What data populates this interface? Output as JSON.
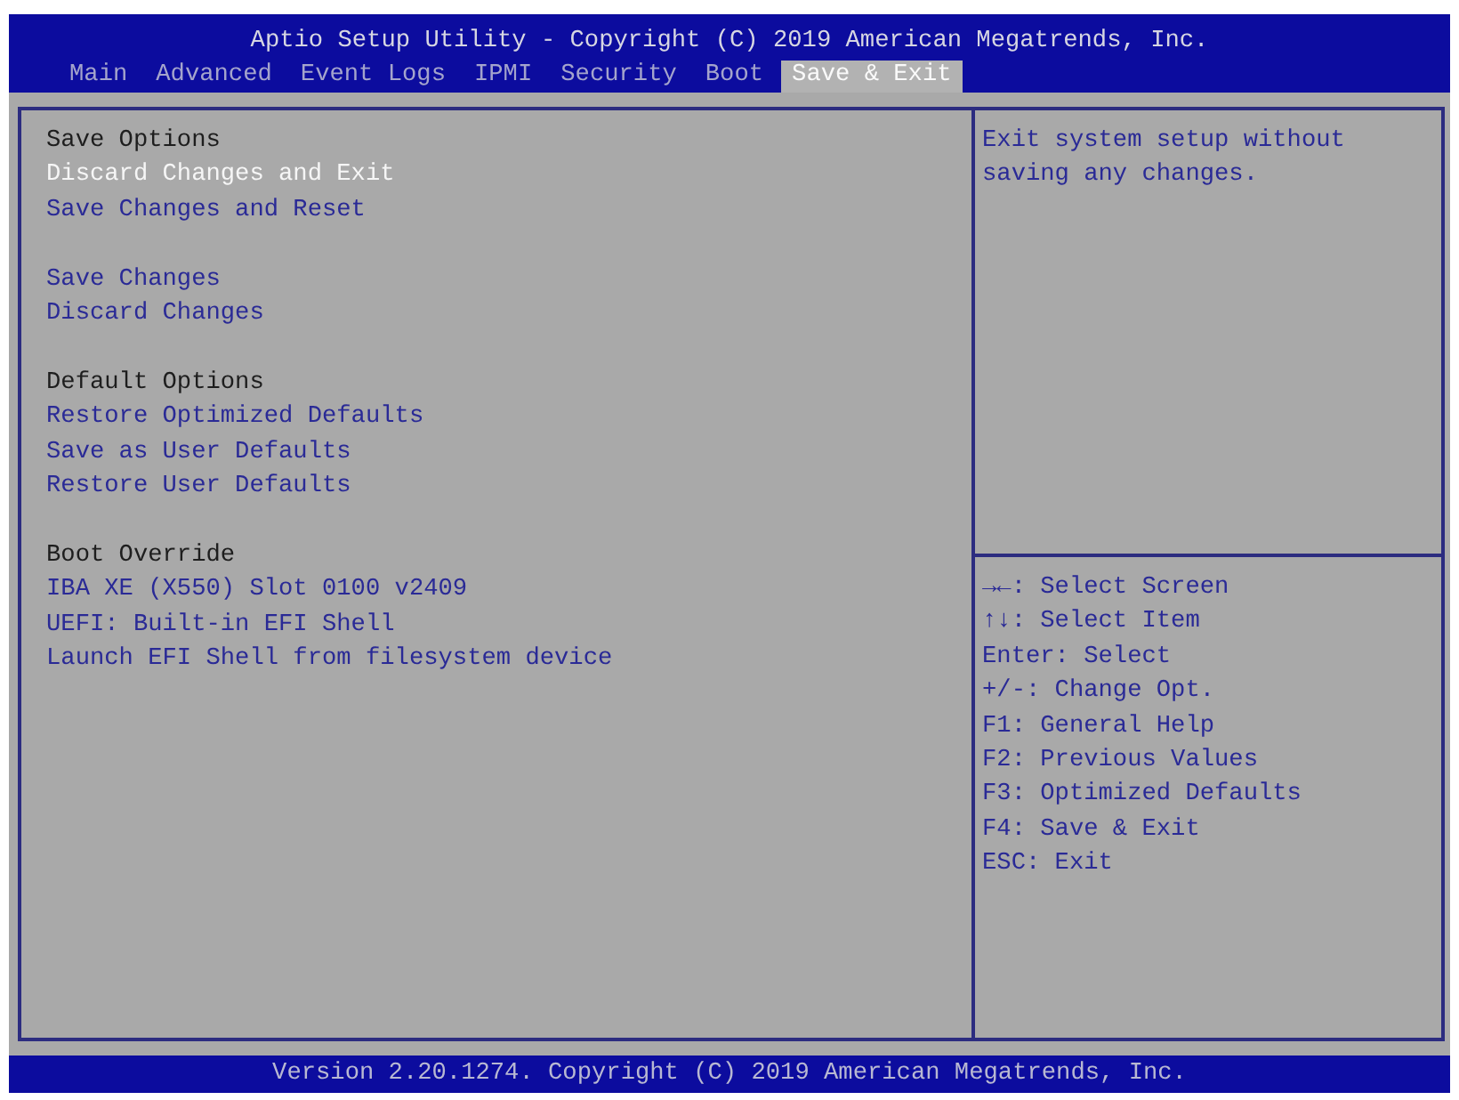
{
  "window": {
    "title": "Aptio Setup Utility - Copyright (C) 2019 American Megatrends, Inc."
  },
  "tabs": [
    {
      "label": "Main",
      "selected": false
    },
    {
      "label": "Advanced",
      "selected": false
    },
    {
      "label": "Event Logs",
      "selected": false
    },
    {
      "label": "IPMI",
      "selected": false
    },
    {
      "label": "Security",
      "selected": false
    },
    {
      "label": "Boot",
      "selected": false
    },
    {
      "label": "Save & Exit",
      "selected": true
    }
  ],
  "sections": [
    {
      "heading": "Save Options",
      "items": [
        {
          "text": "Discard Changes and Exit",
          "selected": true
        },
        {
          "text": "Save Changes and Reset",
          "selected": false
        }
      ]
    },
    {
      "items": [
        {
          "text": "Save Changes",
          "selected": false
        },
        {
          "text": "Discard Changes",
          "selected": false
        }
      ]
    },
    {
      "heading": "Default Options",
      "items": [
        {
          "text": "Restore Optimized Defaults",
          "selected": false
        },
        {
          "text": "Save as User Defaults",
          "selected": false
        },
        {
          "text": "Restore User Defaults",
          "selected": false
        }
      ]
    },
    {
      "heading": "Boot Override",
      "items": [
        {
          "text": "IBA XE (X550) Slot 0100 v2409",
          "selected": false
        },
        {
          "text": "UEFI: Built-in EFI Shell",
          "selected": false
        },
        {
          "text": "Launch EFI Shell from filesystem device",
          "selected": false
        }
      ]
    }
  ],
  "help": {
    "text": "Exit system setup without saving any changes."
  },
  "key_hints": [
    "→←: Select Screen",
    "↑↓: Select Item",
    "Enter: Select",
    "+/-: Change Opt.",
    "F1: General Help",
    "F2: Previous Values",
    "F3: Optimized Defaults",
    "F4: Save & Exit",
    "ESC: Exit"
  ],
  "status_bar": {
    "text": "Version 2.20.1274. Copyright (C) 2019 American Megatrends, Inc."
  }
}
